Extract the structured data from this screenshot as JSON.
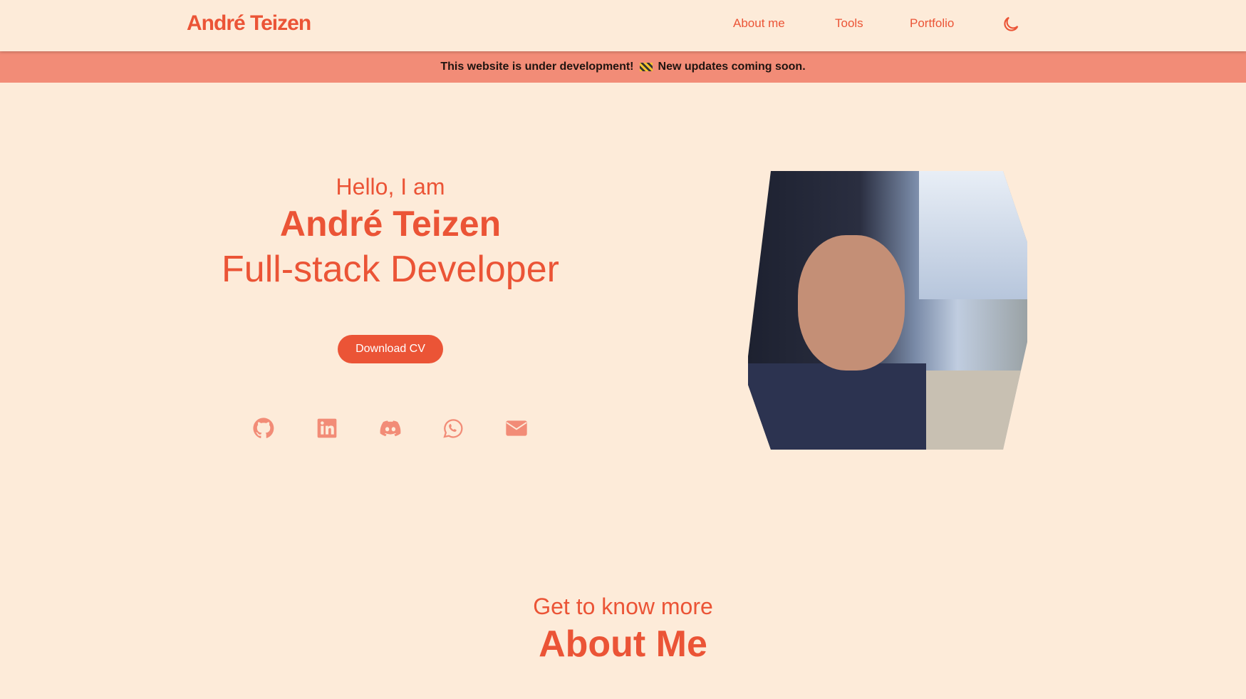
{
  "nav": {
    "logo": "André Teizen",
    "links": [
      "About me",
      "Tools",
      "Portfolio"
    ]
  },
  "banner": {
    "text_before": "This website is under development!",
    "text_after": "New updates coming soon."
  },
  "hero": {
    "greeting": "Hello, I am",
    "name": "André Teizen",
    "role": "Full-stack Developer",
    "download_cv": "Download CV"
  },
  "socials": [
    "github-icon",
    "linkedin-icon",
    "discord-icon",
    "whatsapp-icon",
    "email-icon"
  ],
  "about": {
    "subtitle": "Get to know more",
    "title": "About Me"
  },
  "colors": {
    "background": "#fdebd9",
    "accent": "#eb5436",
    "banner": "#f28c77"
  }
}
